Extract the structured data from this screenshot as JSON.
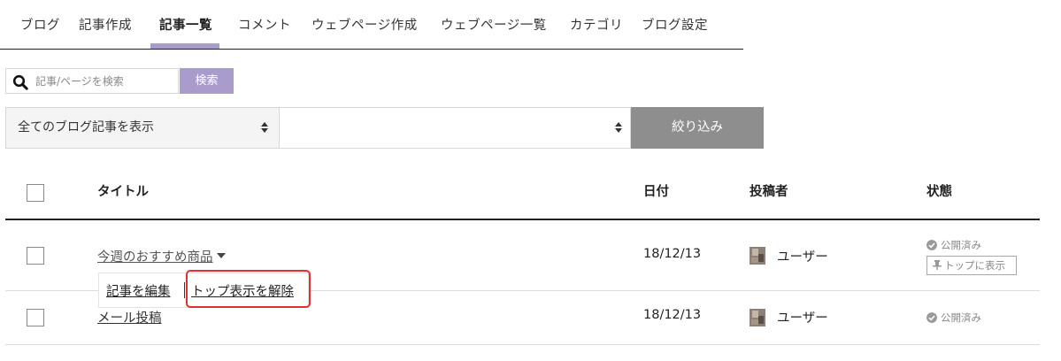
{
  "tabs": [
    {
      "label": "ブログ",
      "active": false
    },
    {
      "label": "記事作成",
      "active": false
    },
    {
      "label": "記事一覧",
      "active": true
    },
    {
      "label": "コメント",
      "active": false
    },
    {
      "label": "ウェブページ作成",
      "active": false
    },
    {
      "label": "ウェブページ一覧",
      "active": false
    },
    {
      "label": "カテゴリ",
      "active": false
    },
    {
      "label": "ブログ設定",
      "active": false
    }
  ],
  "search": {
    "placeholder": "記事/ページを検索",
    "button_label": "検索",
    "icon": "search-icon"
  },
  "filter": {
    "select1_value": "全てのブログ記事を表示",
    "select2_value": "",
    "button_label": "絞り込み"
  },
  "table": {
    "headers": {
      "title": "タイトル",
      "date": "日付",
      "author": "投稿者",
      "status": "状態"
    },
    "rows": [
      {
        "title": "今週のおすすめ商品",
        "date": "18/12/13",
        "author": "ユーザー",
        "status": "公開済み",
        "badge": "トップに表示"
      },
      {
        "title": "メール投稿",
        "date": "18/12/13",
        "author": "ユーザー",
        "status": "公開済み"
      }
    ]
  },
  "actions": {
    "edit": "記事を編集",
    "unpin": "トップ表示を解除"
  },
  "colors": {
    "accent": "#a99ccd",
    "filter_button": "#8e8e8e",
    "highlight": "#e03030"
  }
}
